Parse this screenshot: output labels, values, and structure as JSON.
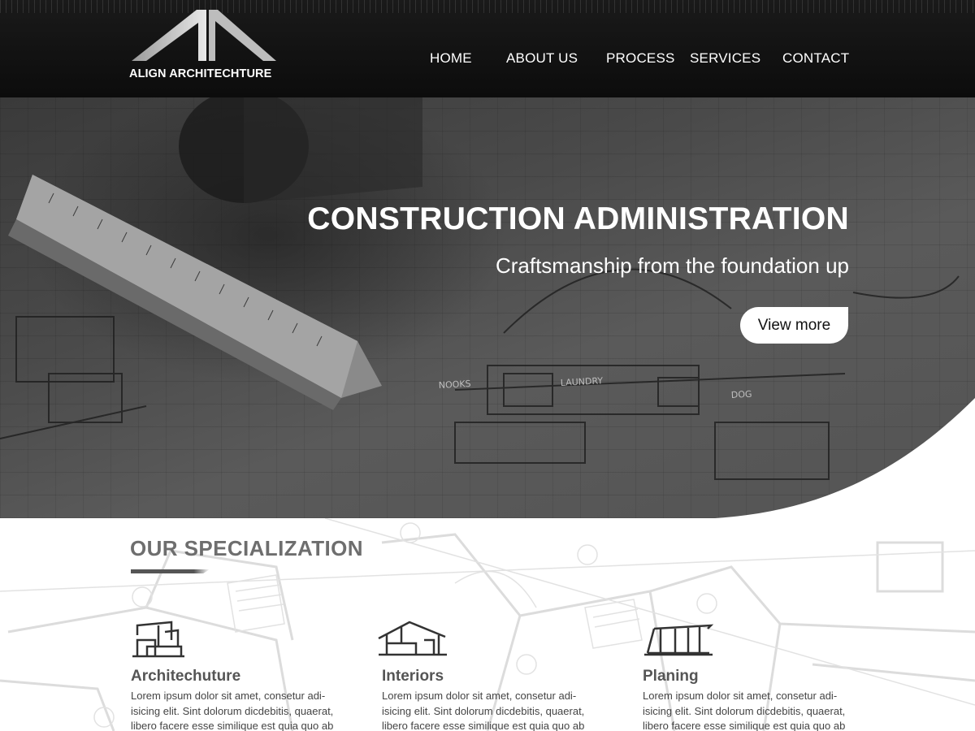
{
  "header": {
    "logo_text": "ALIGN ARCHITECHTURE",
    "nav": [
      {
        "label": "HOME"
      },
      {
        "label": "ABOUT US"
      },
      {
        "label": "PROCESS"
      },
      {
        "label": "SERVICES"
      },
      {
        "label": "CONTACT"
      }
    ]
  },
  "hero": {
    "title": "CONSTRUCTION ADMINISTRATION",
    "subtitle": "Craftsmanship from the foundation up",
    "button_label": "View more"
  },
  "specialization": {
    "title": "OUR SPECIALIZATION",
    "cards": [
      {
        "icon": "modern-building-icon",
        "title": "Architechuture",
        "text": "Lorem ipsum dolor sit amet, consetur adi-isicing elit. Sint dolorum dicdebitis, quaerat, libero facere esse similique est quia quo ab"
      },
      {
        "icon": "house-icon",
        "title": "Interiors",
        "text": "Lorem ipsum dolor sit amet, consetur adi-isicing elit. Sint dolorum dicdebitis, quaerat, libero facere esse similique est quia quo ab"
      },
      {
        "icon": "pavilion-icon",
        "title": "Planing",
        "text": "Lorem ipsum dolor sit amet, consetur adi-isicing elit. Sint dolorum dicdebitis, quaerat, libero facere esse similique est quia quo ab"
      }
    ]
  },
  "colors": {
    "header_bg": "#111111",
    "text_light": "#ffffff",
    "heading_gray": "#6e6e6e"
  }
}
